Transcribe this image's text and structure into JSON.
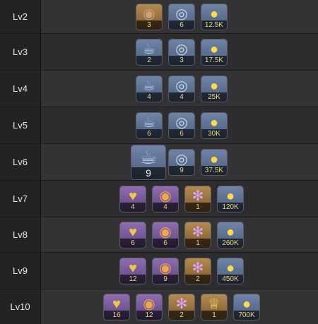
{
  "rows": [
    {
      "level": "Lv2",
      "counts": [
        "3",
        "6",
        "12.5K"
      ]
    },
    {
      "level": "Lv3",
      "counts": [
        "2",
        "3",
        "17.5K"
      ]
    },
    {
      "level": "Lv4",
      "counts": [
        "4",
        "4",
        "25K"
      ]
    },
    {
      "level": "Lv5",
      "counts": [
        "6",
        "6",
        "30K"
      ]
    },
    {
      "level": "Lv6",
      "counts": [
        "9",
        "9",
        "37.5K"
      ]
    },
    {
      "level": "Lv7",
      "counts": [
        "4",
        "4",
        "1",
        "120K"
      ]
    },
    {
      "level": "Lv8",
      "counts": [
        "6",
        "6",
        "1",
        "260K"
      ]
    },
    {
      "level": "Lv9",
      "counts": [
        "12",
        "9",
        "2",
        "450K"
      ]
    },
    {
      "level": "Lv10",
      "counts": [
        "16",
        "12",
        "2",
        "1",
        "700K"
      ]
    }
  ],
  "icons": {
    "shell": "shell-icon",
    "pearl": "pearl-icon",
    "coin": "gold-coin-icon",
    "teapot": "teapot-icon",
    "heart": "golden-relic-icon",
    "spiral": "spiral-orb-icon",
    "claw": "claw-icon",
    "crown": "crown-icon"
  }
}
